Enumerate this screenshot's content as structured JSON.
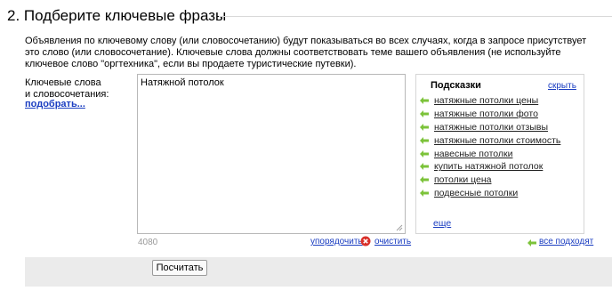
{
  "section": {
    "title": "2. Подберите ключевые фразы"
  },
  "description": {
    "text": "Объявления по ключевому слову (или словосочетанию) будут показываться во всех случаях, когда в запросе присутствует это слово (или словосочетание). Ключевые слова должны соответствовать теме вашего объявления (не используйте ключевое слово \"оргтехника\", если вы продаете туристические путевки)."
  },
  "keywords": {
    "label_line1": "Ключевые слова",
    "label_line2": "и словосочетания:",
    "pick_link": "подобрать...",
    "textarea_value": "Натяжной потолок",
    "char_count": "4080",
    "order_link": "упорядочить",
    "clear_link": "очистить",
    "clear_icon": "close-circle-icon"
  },
  "hints": {
    "title": "Подсказки",
    "hide_link": "скрыть",
    "arrow_icon": "arrow-left-icon",
    "arrow_color": "#7cc33a",
    "items": [
      {
        "label": "натяжные потолки цены"
      },
      {
        "label": "натяжные потолки фото"
      },
      {
        "label": "натяжные потолки отзывы"
      },
      {
        "label": "натяжные потолки стоимость"
      },
      {
        "label": "навесные потолки"
      },
      {
        "label": "купить натяжной потолок"
      },
      {
        "label": "потолки цена"
      },
      {
        "label": "подвесные потолки"
      }
    ],
    "more_link": "еще",
    "all_fit_link": "все подходят"
  },
  "actions": {
    "calculate_button": "Посчитать"
  },
  "colors": {
    "link": "#1a3dc1",
    "clear_icon": "#d9302a",
    "bottom_bar": "#ebebeb"
  }
}
